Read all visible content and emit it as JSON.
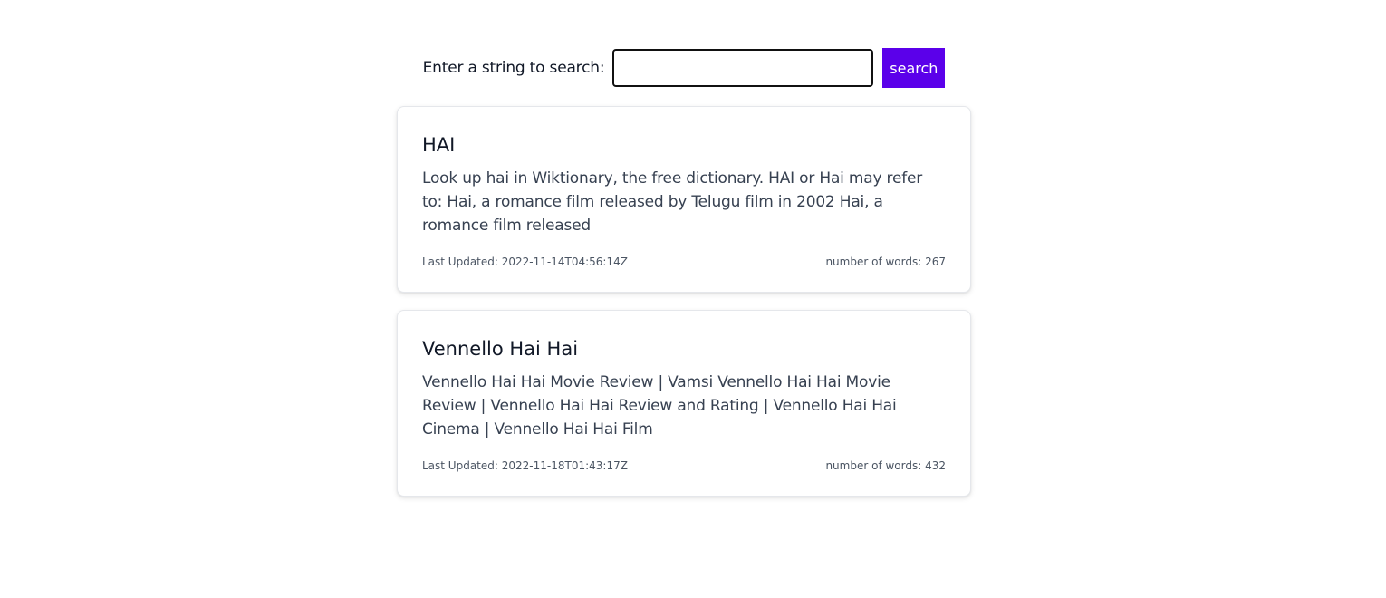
{
  "search": {
    "label": "Enter a string to search:",
    "value": "",
    "placeholder": "",
    "button_label": "search"
  },
  "results": [
    {
      "title": "HAI",
      "snippet": "Look up hai in Wiktionary, the free dictionary. HAI or Hai may refer to: Hai, a romance film released by Telugu film in 2002 Hai, a romance film released",
      "last_updated": "Last Updated: 2022-11-14T04:56:14Z",
      "word_count": "number of words: 267"
    },
    {
      "title": "Vennello Hai Hai",
      "snippet": "Vennello Hai Hai Movie Review | Vamsi Vennello Hai Hai Movie Review | Vennello Hai Hai Review and Rating | Vennello Hai Hai Cinema | Vennello Hai Hai Film",
      "last_updated": "Last Updated: 2022-11-18T01:43:17Z",
      "word_count": "number of words: 432"
    }
  ],
  "colors": {
    "button": "#5b00ea",
    "text": "#111827",
    "snippet": "#374151"
  }
}
